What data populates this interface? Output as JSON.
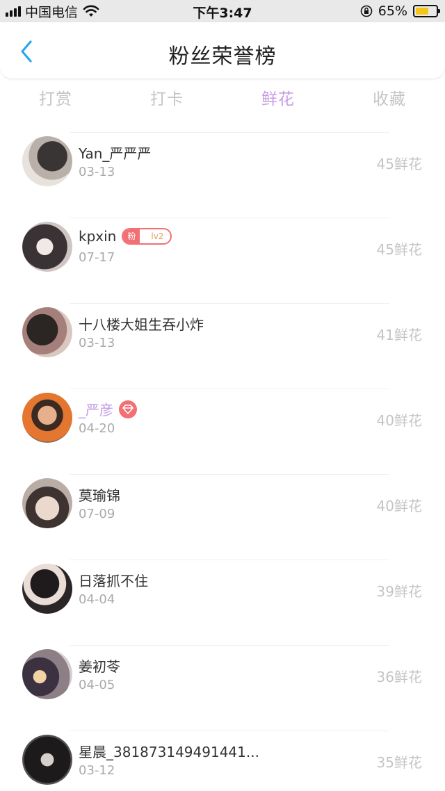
{
  "status_bar": {
    "carrier": "中国电信",
    "time": "下午3:47",
    "battery_percent": "65%",
    "battery_level": 0.65,
    "icons": [
      "signal-icon",
      "wifi-icon",
      "rotation-lock-icon",
      "battery-icon"
    ]
  },
  "header": {
    "title": "粉丝荣誉榜",
    "back_icon": "chevron-left-icon",
    "accent_color": "#2aa6f0"
  },
  "tabs": [
    {
      "label": "打赏",
      "active": false
    },
    {
      "label": "打卡",
      "active": false
    },
    {
      "label": "鲜花",
      "active": true
    },
    {
      "label": "收藏",
      "active": false
    }
  ],
  "colors": {
    "active_tab": "#c79be6",
    "badge": "#f26f74",
    "muted_text": "#c4c4c4"
  },
  "fans": [
    {
      "name": "Yan_严严严",
      "date": "03-13",
      "score": "45鲜花"
    },
    {
      "name": "kpxin",
      "date": "07-17",
      "score": "45鲜花",
      "badge": {
        "left": "粉",
        "right": "lv2"
      }
    },
    {
      "name": "十八楼大姐生吞小炸",
      "date": "03-13",
      "score": "41鲜花"
    },
    {
      "name": "_严彦",
      "date": "04-20",
      "score": "40鲜花",
      "gem_icon": "diamond-icon"
    },
    {
      "name": "莫瑜锦",
      "date": "07-09",
      "score": "40鲜花"
    },
    {
      "name": "日落抓不住",
      "date": "04-04",
      "score": "39鲜花"
    },
    {
      "name": "姜初苓",
      "date": "04-05",
      "score": "36鲜花"
    },
    {
      "name": "星晨_381873149491441...",
      "date": "03-12",
      "score": "35鲜花"
    }
  ]
}
